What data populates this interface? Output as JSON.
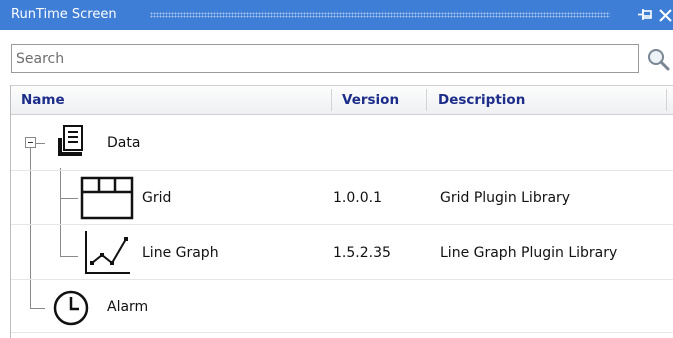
{
  "window": {
    "title": "RunTime Screen"
  },
  "search": {
    "placeholder": "Search",
    "value": ""
  },
  "columns": {
    "name": "Name",
    "version": "Version",
    "description": "Description"
  },
  "tree": {
    "data": {
      "name": "Data",
      "icon": "document-stack-icon",
      "expanded": true
    },
    "grid": {
      "name": "Grid",
      "version": "1.0.0.1",
      "description": "Grid Plugin Library",
      "icon": "grid-table-icon"
    },
    "line_graph": {
      "name": "Line Graph",
      "version": "1.5.2.35",
      "description": "Line Graph Plugin Library",
      "icon": "line-graph-icon"
    },
    "alarm": {
      "name": "Alarm",
      "icon": "clock-icon"
    }
  },
  "colors": {
    "titlebar": "#3e7ed6",
    "header_text": "#1c2d8a"
  }
}
